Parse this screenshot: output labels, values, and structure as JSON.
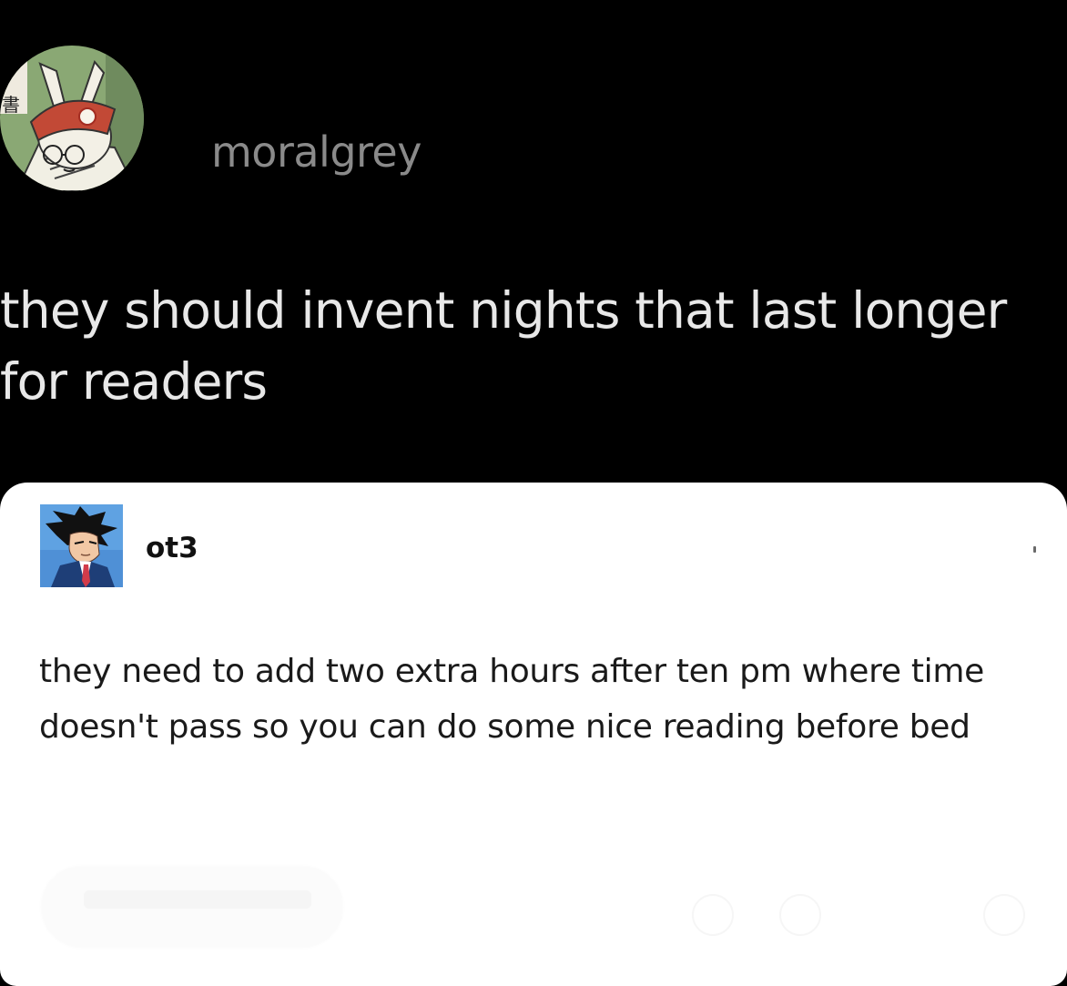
{
  "top_post": {
    "username": "moralgrey",
    "text": "they should invent nights that last longer for readers"
  },
  "reply": {
    "username": "ot3",
    "text": "they need to add two extra hours after ten pm where time doesn't pass so you can do some nice reading before bed"
  },
  "colors": {
    "background": "#000000",
    "card": "#ffffff",
    "top_username": "#8a8a8a",
    "top_text": "#e8e8e8",
    "reply_text": "#1a1a1a"
  },
  "icons": {
    "top_avatar": "rabbit-reading-avatar",
    "reply_avatar": "anime-lawyer-avatar",
    "more": "more-options-icon"
  }
}
